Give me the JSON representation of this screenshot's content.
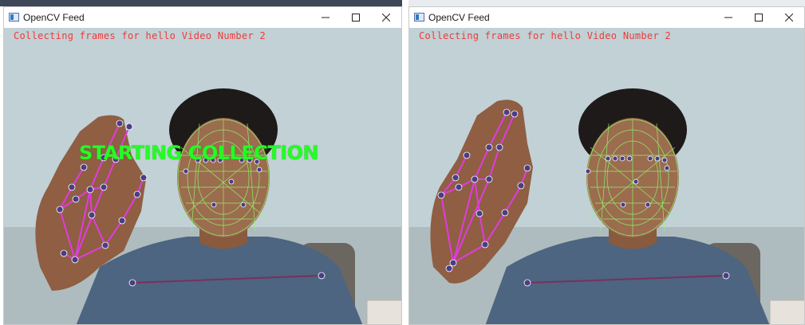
{
  "windows": [
    {
      "title": "OpenCV Feed",
      "status_text": "Collecting frames for hello Video Number 2",
      "banner_text": "STARTING COLLECTION"
    },
    {
      "title": "OpenCV Feed",
      "status_text": "Collecting frames for hello Video Number 2"
    }
  ],
  "icons": {
    "app": "opencv-window-icon",
    "minimize": "minimize-icon",
    "maximize": "maximize-icon",
    "close": "close-icon"
  },
  "colors": {
    "status_text": "#f03a3a",
    "banner_text": "#22ff22",
    "hand_connections": "#e23be0",
    "landmark_points": "#4b3d86",
    "face_mesh": "#8cff6a",
    "pose_line": "#7a2f5e"
  }
}
